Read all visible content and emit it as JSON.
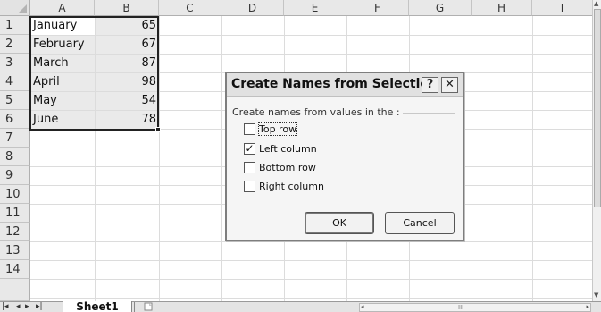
{
  "spreadsheet": {
    "columns": [
      "A",
      "B",
      "C",
      "D",
      "E",
      "F",
      "G",
      "H",
      "I"
    ],
    "rows": [
      "1",
      "2",
      "3",
      "4",
      "5",
      "6",
      "7",
      "8",
      "9",
      "10",
      "11",
      "12",
      "13",
      "14"
    ],
    "data": [
      {
        "month": "January",
        "value": "65"
      },
      {
        "month": "February",
        "value": "67"
      },
      {
        "month": "March",
        "value": "87"
      },
      {
        "month": "April",
        "value": "98"
      },
      {
        "month": "May",
        "value": "54"
      },
      {
        "month": "June",
        "value": "78"
      }
    ]
  },
  "bottom_bar": {
    "nav_first": "|◂",
    "nav_prev": "◂",
    "nav_next": "▸",
    "nav_last": "▸|",
    "sheet_tab": "Sheet1",
    "insert_tab_icon": "insert-sheet-icon",
    "hscroll_grip": "III"
  },
  "dialog": {
    "title": "Create Names from Selection",
    "help_label": "?",
    "close_label": "✕",
    "group_label": "Create names from values in the :",
    "options": [
      {
        "label": "Top row",
        "checked": false
      },
      {
        "label": "Left column",
        "checked": true
      },
      {
        "label": "Bottom row",
        "checked": false
      },
      {
        "label": "Right column",
        "checked": false
      }
    ],
    "ok_label": "OK",
    "cancel_label": "Cancel"
  }
}
